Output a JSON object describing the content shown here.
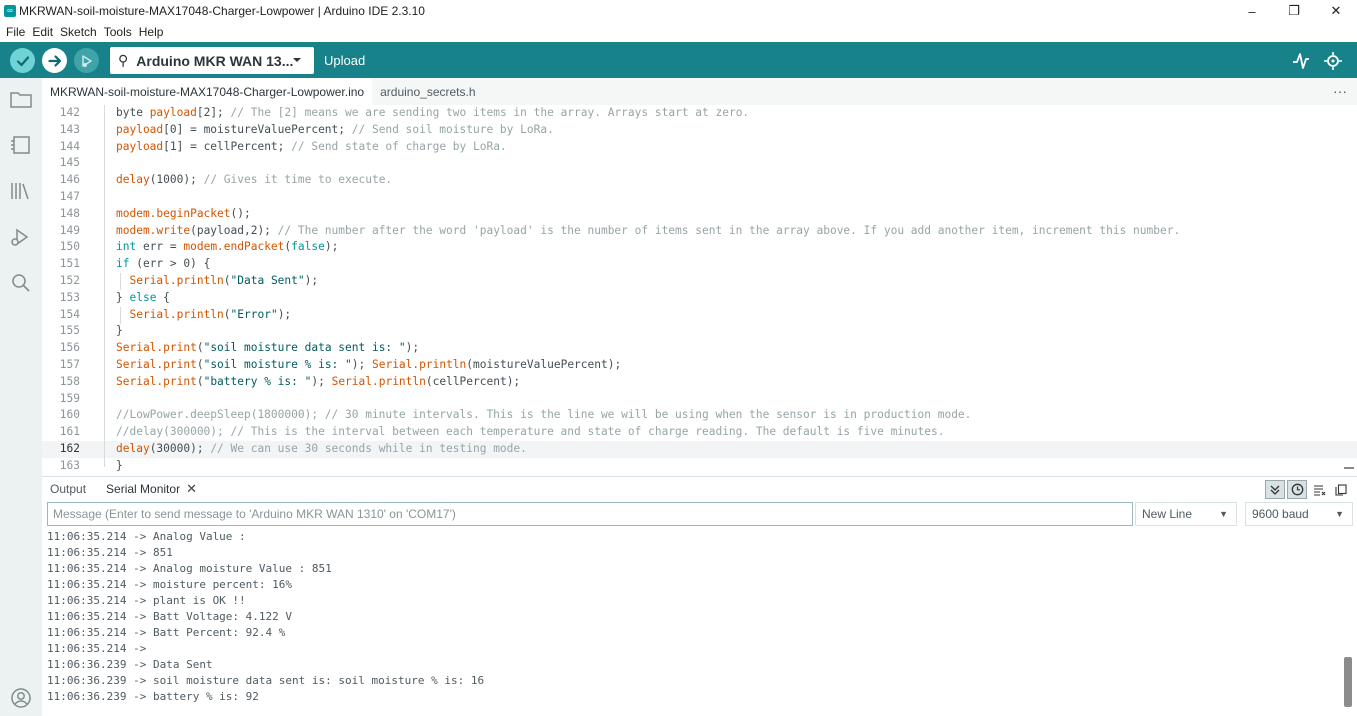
{
  "window": {
    "title": "MKRWAN-soil-moisture-MAX17048-Charger-Lowpower | Arduino IDE 2.3.10",
    "controls": [
      "–",
      "❐",
      "✕"
    ]
  },
  "menu": [
    "File",
    "Edit",
    "Sketch",
    "Tools",
    "Help"
  ],
  "toolbar": {
    "board": "Arduino MKR WAN 13...",
    "hover_label": "Upload",
    "accent": "#17828a"
  },
  "tabs": [
    {
      "label": "MKRWAN-soil-moisture-MAX17048-Charger-Lowpower.ino"
    },
    {
      "label": "arduino_secrets.h"
    }
  ],
  "tab_more": "···",
  "code_lines": [
    {
      "n": "142",
      "html": "byte <span class=\"kw\">payload</span>[2]; <span class=\"cm\">// The [2] means we are sending two items in the array. Arrays start at zero.</span>"
    },
    {
      "n": "143",
      "html": "<span class=\"kw\">payload</span>[0] = moistureValuePercent; <span class=\"cm\">// Send soil moisture by LoRa.</span>"
    },
    {
      "n": "144",
      "html": "<span class=\"kw\">payload</span>[1] = cellPercent; <span class=\"cm\">// Send state of charge by LoRa.</span>"
    },
    {
      "n": "145",
      "html": ""
    },
    {
      "n": "146",
      "html": "<span class=\"kw\">delay</span>(1000); <span class=\"cm\">// Gives it time to execute.</span>"
    },
    {
      "n": "147",
      "html": ""
    },
    {
      "n": "148",
      "html": "<span class=\"kw\">modem.beginPacket</span>();"
    },
    {
      "n": "149",
      "html": "<span class=\"kw\">modem.write</span>(payload,2); <span class=\"cm\">// The number after the word 'payload' is the number of items sent in the array above. If you add another item, increment this number.</span>"
    },
    {
      "n": "150",
      "html": "<span class=\"ty\">int</span> err = <span class=\"kw\">modem.endPacket</span>(<span class=\"ty\">false</span>);"
    },
    {
      "n": "151",
      "html": "<span class=\"ty\">if</span> (err &gt; 0) {"
    },
    {
      "n": "152",
      "html": "  <span class=\"kw\">Serial.println</span>(<span class=\"str\">\"Data Sent\"</span>);"
    },
    {
      "n": "153",
      "html": "} <span class=\"ty\">else</span> {"
    },
    {
      "n": "154",
      "html": "  <span class=\"kw\">Serial.println</span>(<span class=\"str\">\"Error\"</span>);"
    },
    {
      "n": "155",
      "html": "}"
    },
    {
      "n": "156",
      "html": "<span class=\"kw\">Serial.print</span>(<span class=\"str\">\"soil moisture data sent is: \"</span>);"
    },
    {
      "n": "157",
      "html": "<span class=\"kw\">Serial.print</span>(<span class=\"str\">\"soil moisture % is: \"</span>); <span class=\"kw\">Serial.println</span>(moistureValuePercent);"
    },
    {
      "n": "158",
      "html": "<span class=\"kw\">Serial.print</span>(<span class=\"str\">\"battery % is: \"</span>); <span class=\"kw\">Serial.println</span>(cellPercent);"
    },
    {
      "n": "159",
      "html": ""
    },
    {
      "n": "160",
      "html": "<span class=\"cm\">//LowPower.deepSleep(1800000); // 30 minute intervals. This is the line we will be using when the sensor is in production mode.</span>"
    },
    {
      "n": "161",
      "html": "<span class=\"cm\">//delay(300000); // This is the interval between each temperature and state of charge reading. The default is five minutes.</span>"
    },
    {
      "n": "162",
      "html": "<span class=\"kw\">delay</span>(30000); <span class=\"cm\">// We can use 30 seconds while in testing mode.</span>"
    },
    {
      "n": "163",
      "html": "}"
    }
  ],
  "current_line": "162",
  "panel": {
    "tabs": [
      "Output",
      "Serial Monitor"
    ],
    "close": "✕",
    "message_placeholder": "Message (Enter to send message to 'Arduino MKR WAN 1310' on 'COM17')",
    "line_ending": "New Line",
    "baud": "9600 baud"
  },
  "serial_lines": [
    "11:06:35.214 -> Analog Value :",
    "11:06:35.214 -> 851",
    "11:06:35.214 -> Analog moisture Value : 851",
    "11:06:35.214 -> moisture percent: 16%",
    "11:06:35.214 -> plant is OK !!",
    "11:06:35.214 -> Batt Voltage: 4.122 V",
    "11:06:35.214 -> Batt Percent: 92.4 %",
    "11:06:35.214 -> ",
    "11:06:36.239 -> Data Sent",
    "11:06:36.239 -> soil moisture data sent is: soil moisture % is: 16",
    "11:06:36.239 -> battery % is: 92"
  ]
}
